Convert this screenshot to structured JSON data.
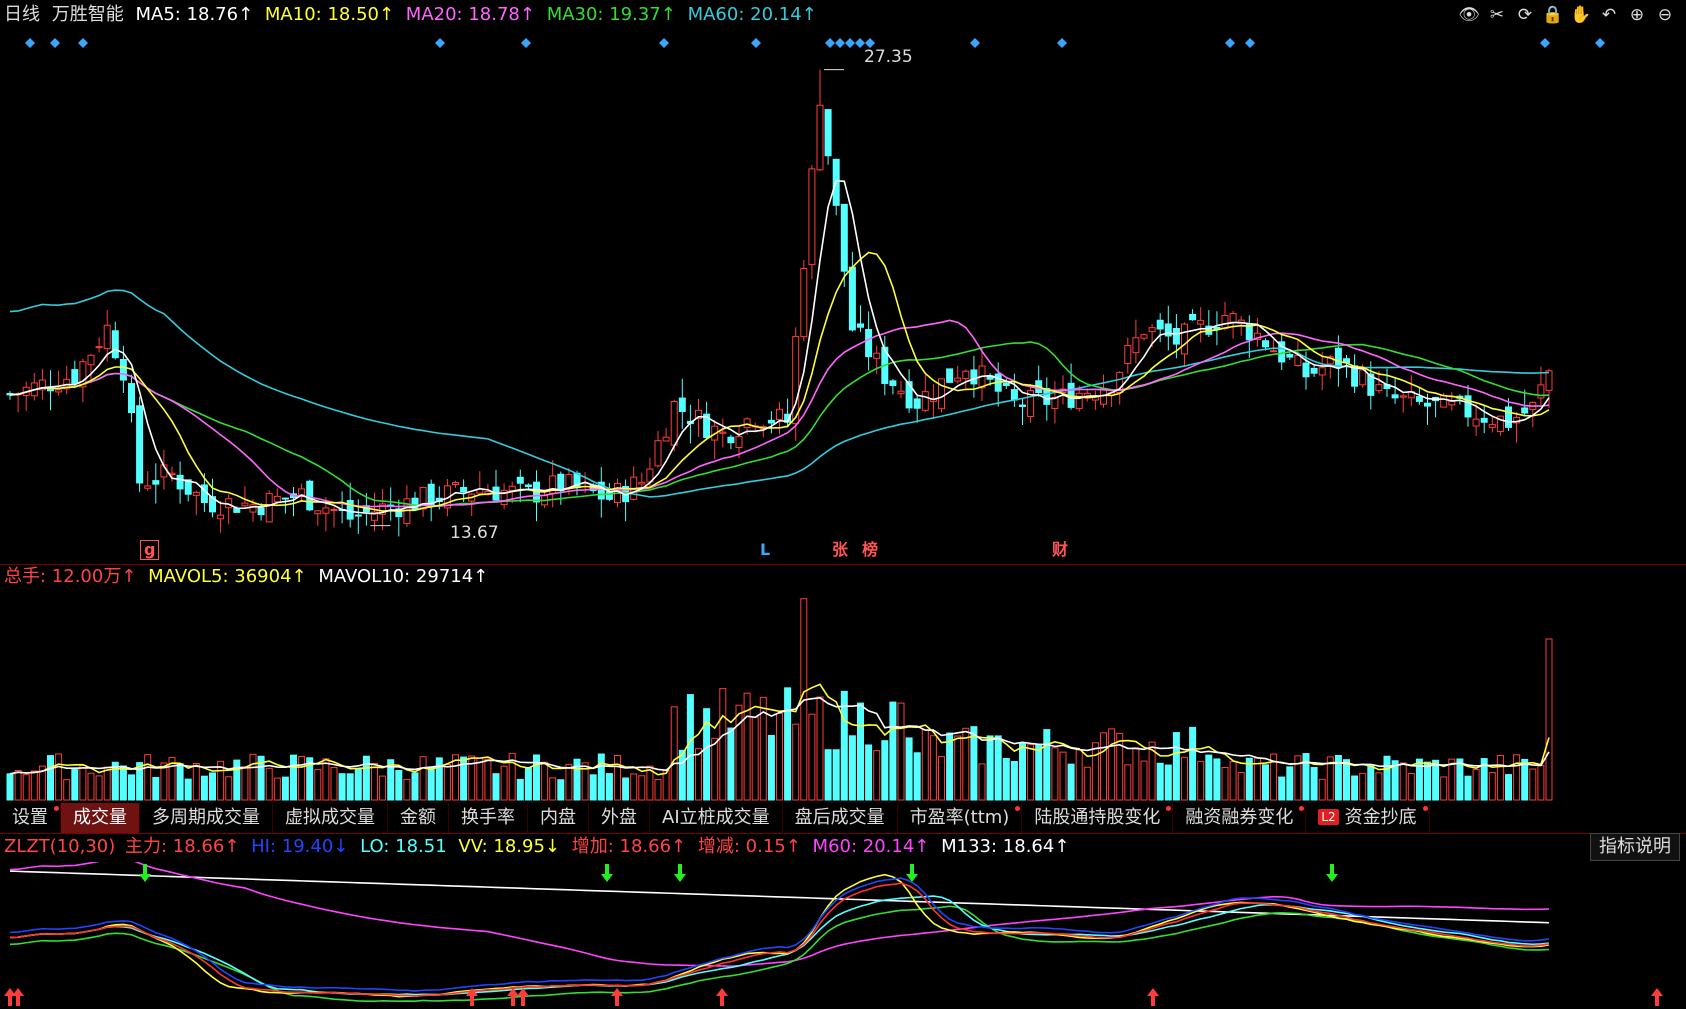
{
  "top_legend": {
    "period": "日线",
    "stock": "万胜智能",
    "ma5": "MA5: 18.76↑",
    "ma10": "MA10: 18.50↑",
    "ma20": "MA20: 18.78↑",
    "ma30": "MA30: 19.37↑",
    "ma60": "MA60: 20.14↑"
  },
  "toolbar": [
    "eye-icon",
    "scissors-icon",
    "replay-icon",
    "lock-icon",
    "hand-icon",
    "undo-icon",
    "zoom-in-icon",
    "zoom-out-icon"
  ],
  "price_annotations": {
    "high": "27.35",
    "low": "13.67"
  },
  "event_markers": [
    {
      "label": "g",
      "color": "#ff5555"
    },
    {
      "label": "L",
      "color": "#3aa7ff"
    },
    {
      "label": "张",
      "color": "#ff5555"
    },
    {
      "label": "榜",
      "color": "#ff5555"
    },
    {
      "label": "财",
      "color": "#ff5555"
    }
  ],
  "volume_legend": {
    "total": "总手: 12.00万↑",
    "mavol5": "MAVOL5: 36904↑",
    "mavol10": "MAVOL10: 29714↑"
  },
  "tabs": [
    {
      "label": "设置",
      "dot": true
    },
    {
      "label": "成交量",
      "active": true
    },
    {
      "label": "多周期成交量"
    },
    {
      "label": "虚拟成交量"
    },
    {
      "label": "金额"
    },
    {
      "label": "换手率"
    },
    {
      "label": "内盘"
    },
    {
      "label": "外盘"
    },
    {
      "label": "AI立桩成交量"
    },
    {
      "label": "盘后成交量"
    },
    {
      "label": "市盈率(ttm)",
      "dot": true
    },
    {
      "label": "陆股通持股变化",
      "dot": true
    },
    {
      "label": "融资融券变化",
      "dot": true
    },
    {
      "label": "资金抄底",
      "badge": "L2",
      "dot": true
    }
  ],
  "indicator_legend": {
    "name": "ZLZT(10,30)",
    "main": "主力: 18.66↑",
    "hi": "HI: 19.40↓",
    "lo": "LO: 18.51",
    "vv": "VV: 18.95↓",
    "inc": "增加: 18.66↑",
    "delta": "增减: 0.15↑",
    "m60": "M60: 20.14↑",
    "m133": "M133: 18.64↑"
  },
  "indicator_button": "指标说明",
  "colors": {
    "up": "#ff3c3c",
    "down": "#54ffff",
    "ma5": "#ffffff",
    "ma10": "#ffff33",
    "ma20": "#ff66ff",
    "ma30": "#33dd33",
    "ma60": "#33ccdd"
  }
}
